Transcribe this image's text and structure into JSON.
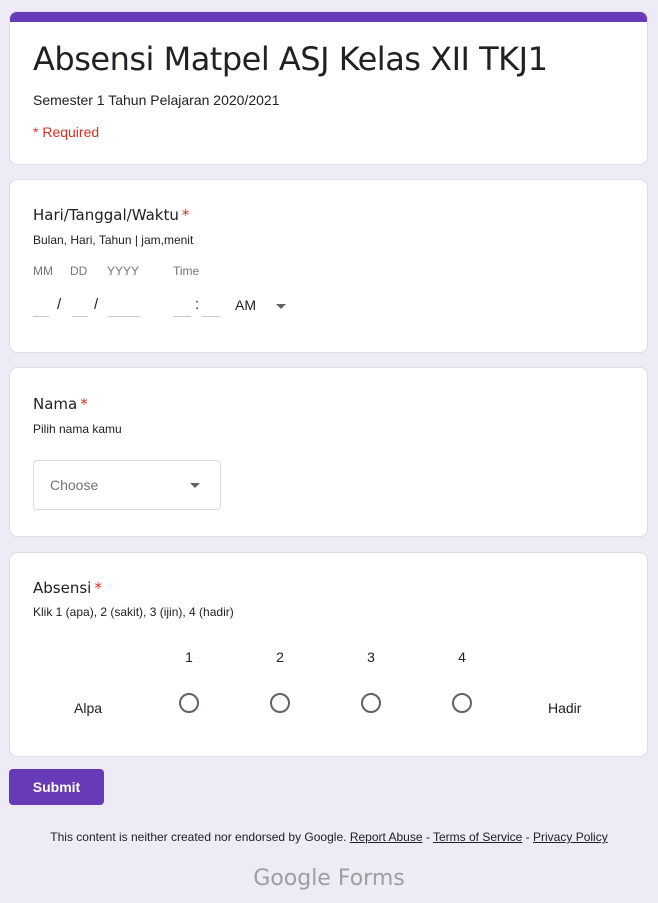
{
  "header": {
    "title": "Absensi Matpel ASJ Kelas XII TKJ1",
    "description": "Semester 1 Tahun Pelajaran 2020/2021",
    "required_note": "* Required",
    "accent_color": "#673ab7"
  },
  "questions": [
    {
      "title": "Hari/Tanggal/Waktu",
      "required_mark": "*",
      "help": "Bulan, Hari, Tahun | jam,menit",
      "date_labels": {
        "month": "MM",
        "day": "DD",
        "year": "YYYY",
        "time": "Time"
      },
      "separators": {
        "date": "/",
        "time": ":"
      },
      "values": {
        "month": "",
        "day": "",
        "year": "",
        "hour": "",
        "minute": ""
      },
      "ampm": "AM"
    },
    {
      "title": "Nama",
      "required_mark": "*",
      "help": "Pilih nama kamu",
      "dropdown_placeholder": "Choose"
    },
    {
      "title": "Absensi",
      "required_mark": "*",
      "help": "Klik 1 (apa), 2 (sakit), 3 (ijin), 4 (hadir)",
      "scale": [
        "1",
        "2",
        "3",
        "4"
      ],
      "low_label": "Alpa",
      "high_label": "Hadir",
      "selected": null
    }
  ],
  "submit_label": "Submit",
  "footer": {
    "disclaimer": "This content is neither created nor endorsed by Google.",
    "links": [
      "Report Abuse",
      "Terms of Service",
      "Privacy Policy"
    ],
    "separator": " - ",
    "brand_google": "Google",
    "brand_forms": " Forms"
  }
}
